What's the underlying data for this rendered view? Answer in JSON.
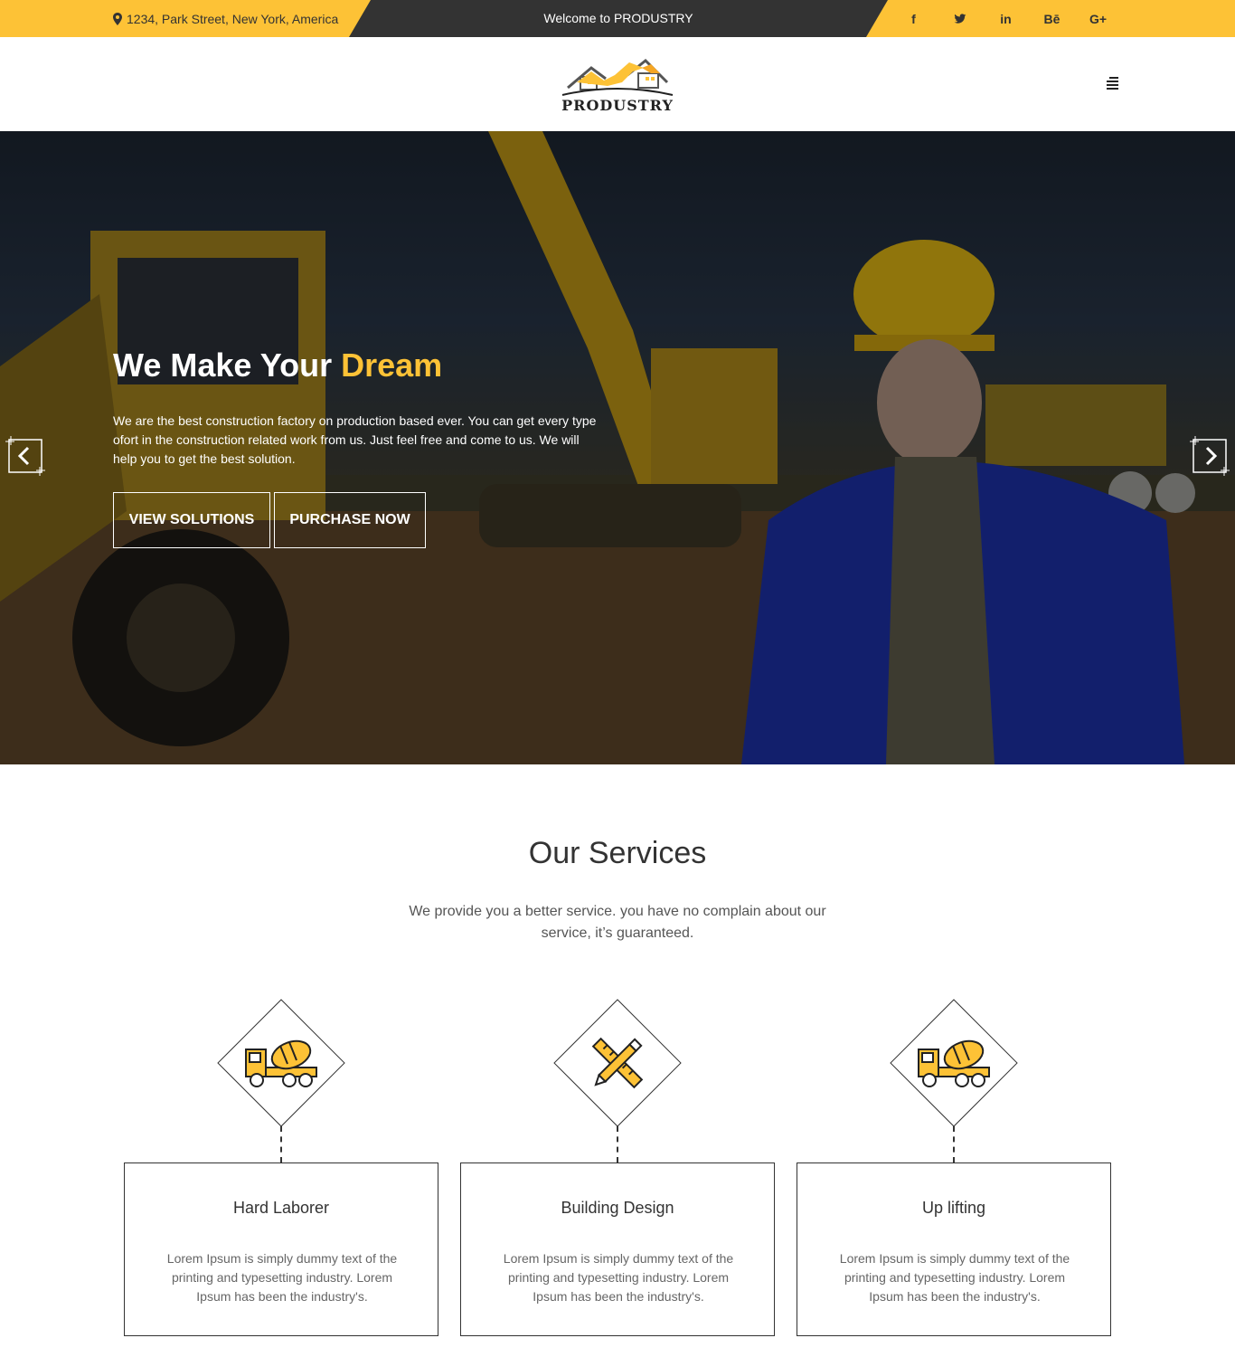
{
  "topbar": {
    "address": "1234, Park Street, New York, America",
    "welcome": "Welcome to PRODUSTRY",
    "social": [
      {
        "icon": "facebook-icon",
        "label": "f"
      },
      {
        "icon": "twitter-icon",
        "label": ""
      },
      {
        "icon": "linkedin-icon",
        "label": "in"
      },
      {
        "icon": "behance-icon",
        "label": "Bē"
      },
      {
        "icon": "google-plus-icon",
        "label": "G+"
      }
    ],
    "colors": {
      "accent": "#fdc236",
      "dark": "#333333"
    }
  },
  "header": {
    "logo_text": "PRODUSTRY",
    "menu_icon": "hamburger-menu-icon"
  },
  "hero": {
    "title_main": "We Make Your ",
    "title_accent": "Dream",
    "text": "We are the best construction factory on production based ever. You can get every type ofort in the construction related work from us. Just feel free and come to us. We will help you to get the best solution.",
    "buttons": {
      "view": "VIEW SOLUTIONS",
      "purchase": "PURCHASE NOW"
    },
    "prev_icon": "chevron-left-icon",
    "next_icon": "chevron-right-icon"
  },
  "services": {
    "title": "Our Services",
    "subtitle": "We provide you a better service. you have no complain about our service, it’s guaranteed.",
    "items": [
      {
        "icon": "concrete-mixer-truck-icon",
        "title": "Hard Laborer",
        "text": "Lorem Ipsum is simply dummy text of the printing and typesetting industry. Lorem Ipsum has been the industry's."
      },
      {
        "icon": "pencil-ruler-icon",
        "title": "Building Design",
        "text": "Lorem Ipsum is simply dummy text of the printing and typesetting industry. Lorem Ipsum has been the industry's."
      },
      {
        "icon": "concrete-mixer-truck-icon",
        "title": "Up lifting",
        "text": "Lorem Ipsum is simply dummy text of the printing and typesetting industry. Lorem Ipsum has been the industry's."
      }
    ]
  }
}
